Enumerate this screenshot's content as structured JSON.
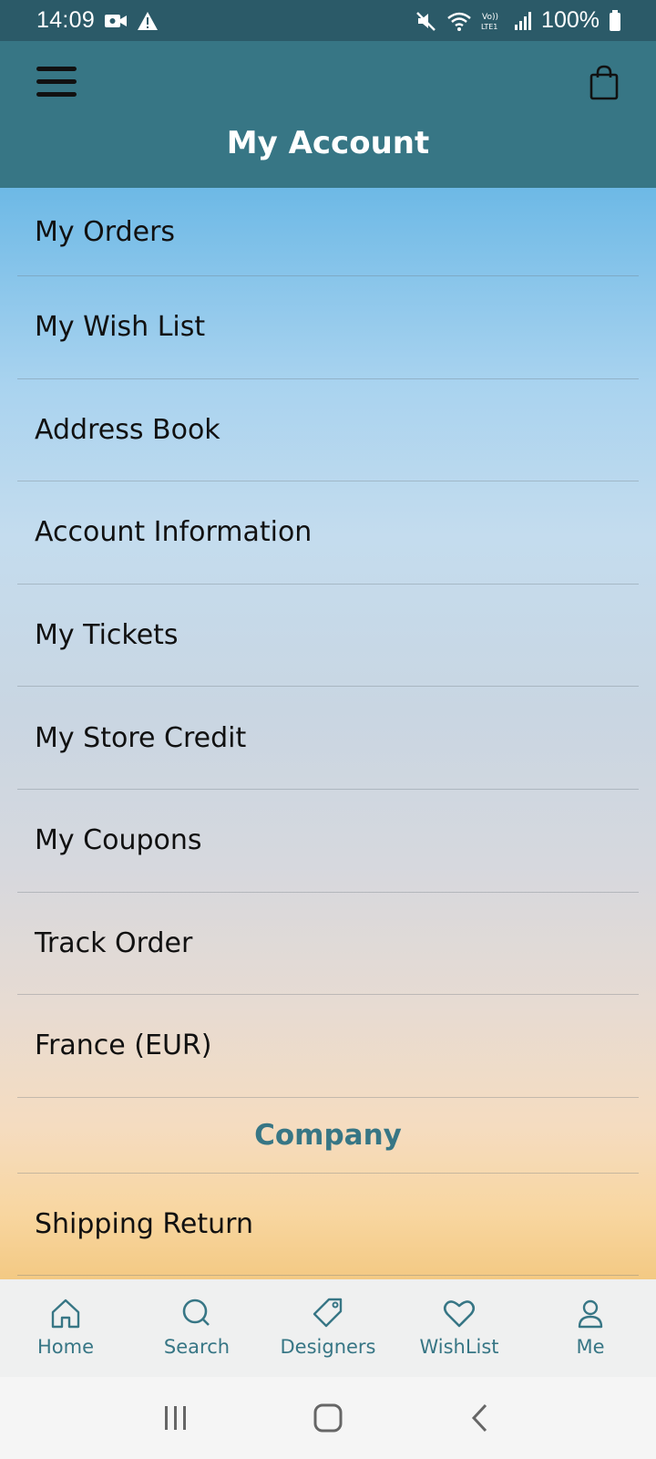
{
  "status_bar": {
    "time": "14:09",
    "battery": "100%",
    "icons": [
      "video-call-icon",
      "warning-icon",
      "mute-icon",
      "wifi-icon",
      "volte-icon",
      "signal-icon",
      "battery-icon"
    ]
  },
  "header": {
    "title": "My Account",
    "menu_icon": "hamburger-menu-icon",
    "cart_icon": "shopping-bag-icon"
  },
  "menu": {
    "items": [
      {
        "label": "My Orders"
      },
      {
        "label": "My Wish List"
      },
      {
        "label": "Address Book"
      },
      {
        "label": "Account Information"
      },
      {
        "label": "My Tickets"
      },
      {
        "label": "My Store Credit"
      },
      {
        "label": "My Coupons"
      },
      {
        "label": "Track Order"
      },
      {
        "label": "France (EUR)"
      }
    ],
    "section_header": "Company",
    "company_items": [
      {
        "label": "Shipping Return"
      }
    ]
  },
  "tabs": [
    {
      "label": "Home",
      "icon": "home-icon"
    },
    {
      "label": "Search",
      "icon": "search-icon"
    },
    {
      "label": "Designers",
      "icon": "tag-icon"
    },
    {
      "label": "WishList",
      "icon": "heart-icon"
    },
    {
      "label": "Me",
      "icon": "user-icon"
    }
  ],
  "colors": {
    "header_bg": "#377685",
    "status_bg": "#2b5a68",
    "accent": "#377685",
    "tab_bar_bg": "#eff0f0"
  }
}
